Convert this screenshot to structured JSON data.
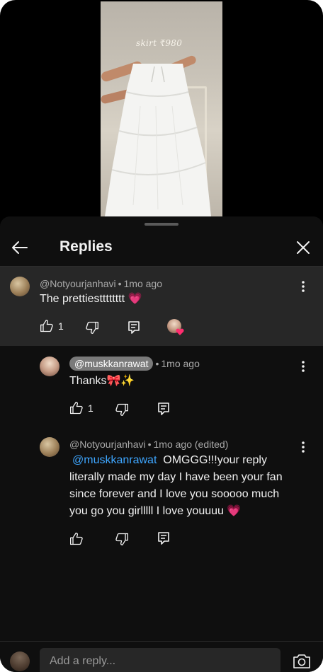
{
  "video": {
    "caption": "skirt ₹980"
  },
  "header": {
    "title": "Replies"
  },
  "parent_comment": {
    "author": "@Notyourjanhavi",
    "time": "1mo ago",
    "text": "The prettiestttttttt 💗",
    "likes": "1"
  },
  "replies": [
    {
      "author": "@muskkanrawat",
      "time": "1mo ago",
      "text": "Thanks🎀✨",
      "likes": "1"
    },
    {
      "author": "@Notyourjanhavi",
      "time": "1mo ago (edited)",
      "mention": "@muskkanrawat",
      "text": "OMGGG!!!your reply literally made my day I have been your fan since forever and I love you sooooo much you go you girlllll I love youuuu 💗",
      "likes": ""
    }
  ],
  "composer": {
    "placeholder": "Add a reply..."
  },
  "icons": {
    "back": "arrow-left-icon",
    "close": "close-icon",
    "more": "more-vert-icon",
    "like": "thumb-up-icon",
    "dislike": "thumb-down-icon",
    "reply": "reply-icon",
    "camera": "camera-icon"
  },
  "colors": {
    "mention": "#3ea6ff",
    "heart": "#ff2d6f",
    "sheet_bg": "#0f0f0f",
    "highlight_bg": "#272727"
  }
}
